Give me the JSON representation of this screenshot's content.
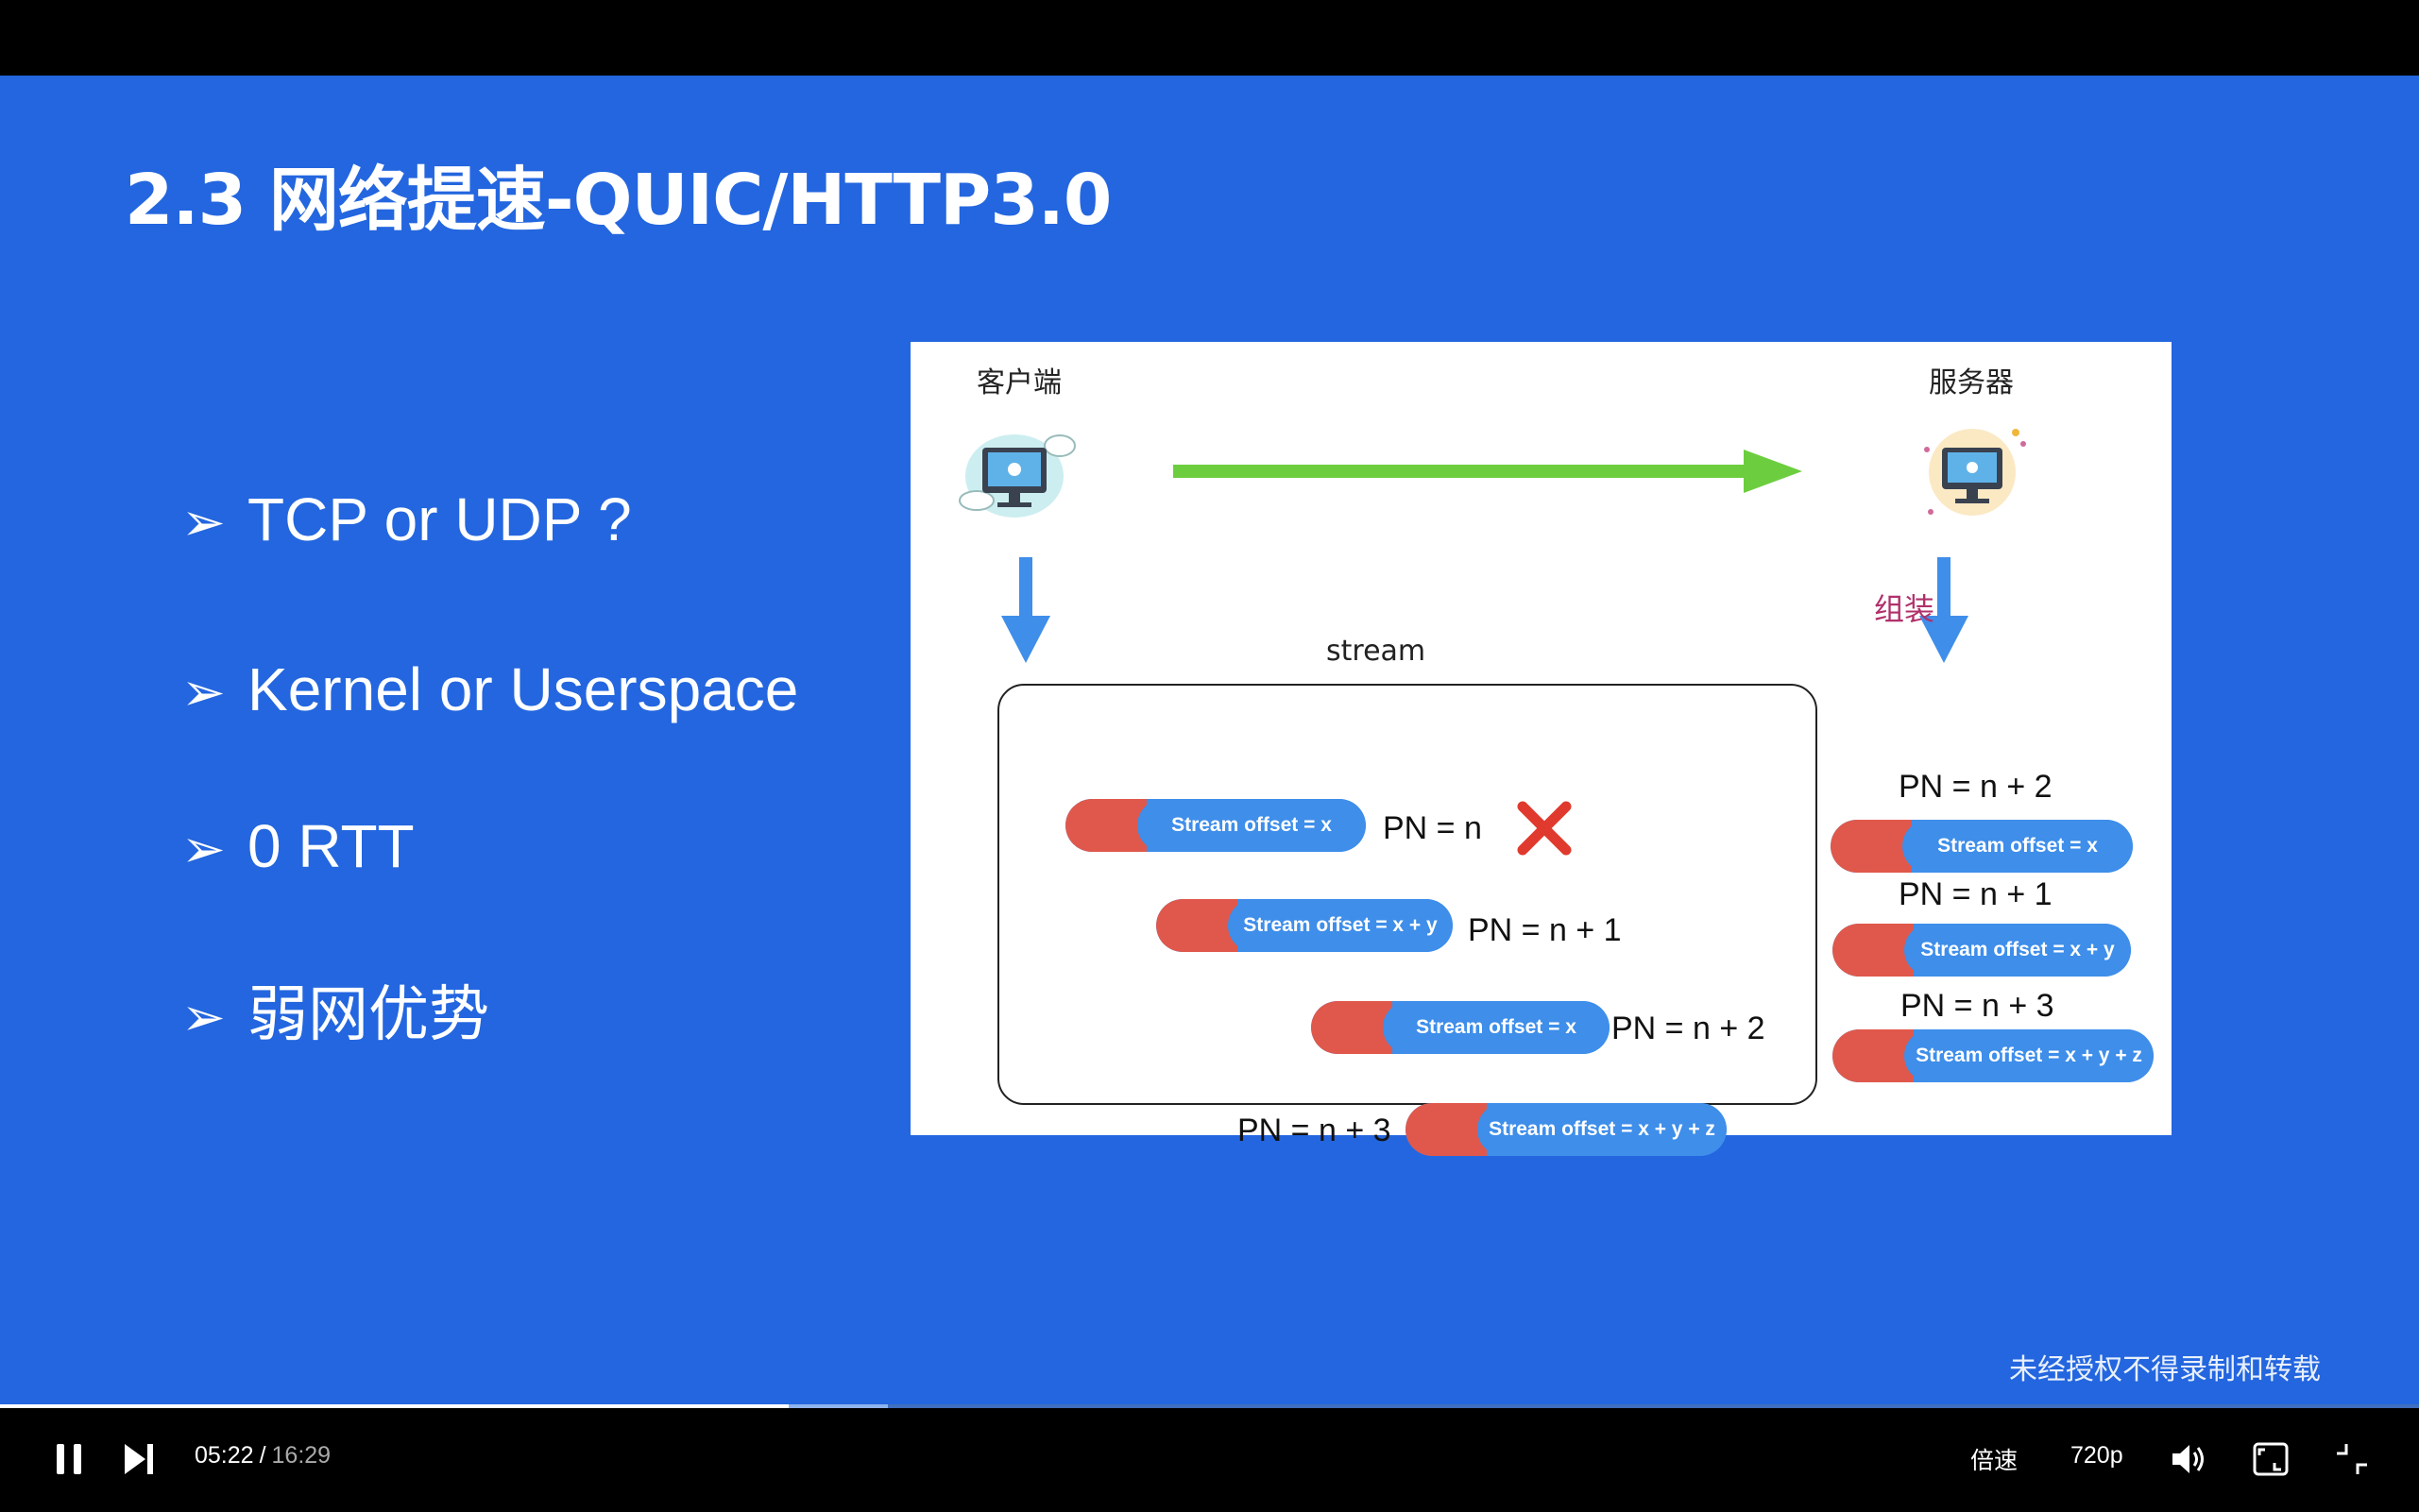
{
  "slide": {
    "title": "2.3 网络提速-QUIC/HTTP3.0",
    "bullet_marker": "➢",
    "bullets": [
      "TCP or UDP ?",
      "Kernel or Userspace",
      "0 RTT",
      "弱网优势"
    ],
    "watermark": "未经授权不得录制和转载"
  },
  "diagram": {
    "client_label": "客户端",
    "server_label": "服务器",
    "assemble_label": "组装",
    "stream_label": "stream",
    "client_packets": [
      {
        "text": "Stream offset = x",
        "pn": "PN = n"
      },
      {
        "text": "Stream offset = x + y",
        "pn": "PN = n + 1"
      },
      {
        "text": "Stream offset = x",
        "pn": "PN = n + 2"
      },
      {
        "text": "Stream offset = x + y + z",
        "pn": "PN = n + 3"
      }
    ],
    "server_packets": [
      {
        "pn": "PN = n + 2",
        "text": "Stream offset = x"
      },
      {
        "pn": "PN = n + 1",
        "text": "Stream offset = x + y"
      },
      {
        "pn": "PN = n + 3",
        "text": "Stream offset = x + y + z"
      }
    ],
    "colors": {
      "arrow_green": "#6cce3f",
      "arrow_blue": "#3f8ee9",
      "cross_red": "#e03a2e",
      "assemble": "#b0306a"
    }
  },
  "player": {
    "current_time": "05:22",
    "separator": "/",
    "duration": "16:29",
    "played_fraction": 0.326,
    "buffered_fraction": 0.367,
    "speed_label": "倍速",
    "quality_label": "720p",
    "icons": [
      "pause-icon",
      "next-icon",
      "volume-icon",
      "pip-icon",
      "exit-fullscreen-icon"
    ]
  }
}
